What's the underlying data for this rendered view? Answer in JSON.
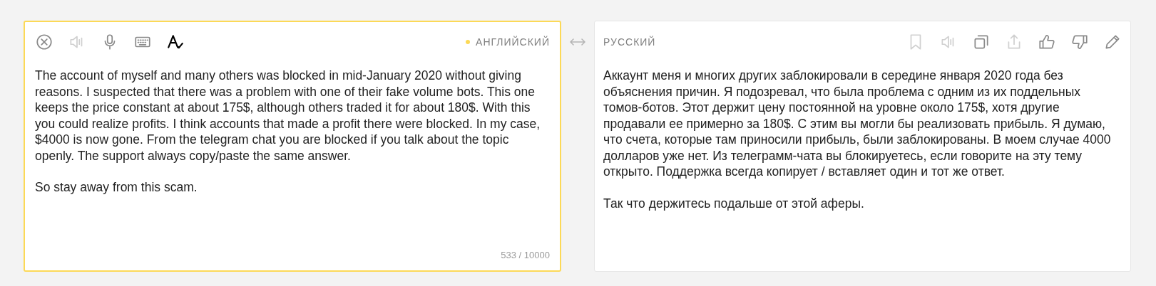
{
  "source": {
    "language": "АНГЛИЙСКИЙ",
    "tools": [
      {
        "kind": "clear",
        "disabled": false
      },
      {
        "kind": "speaker",
        "disabled": true
      },
      {
        "kind": "mic",
        "disabled": false
      },
      {
        "kind": "keyboard",
        "disabled": false
      },
      {
        "kind": "spellcheck",
        "disabled": false
      }
    ],
    "paragraphs": [
      "The account of myself and many others was blocked in mid-January 2020 without giving reasons. I suspected that there was a problem with one of their fake volume bots. This one keeps the price constant at about 175$, although others traded it for about 180$. With this you could realize profits. I think accounts that made a profit there were blocked. In my case, $4000 is now gone. From the telegram chat you are blocked if you talk about the topic openly. The support always copy/paste the same answer.",
      "So stay away from this scam."
    ],
    "counter": "533 / 10000"
  },
  "target": {
    "language": "РУССКИЙ",
    "tools": [
      {
        "kind": "bookmark",
        "disabled": true
      },
      {
        "kind": "speaker",
        "disabled": true
      },
      {
        "kind": "copy",
        "disabled": false
      },
      {
        "kind": "share",
        "disabled": true
      },
      {
        "kind": "like",
        "disabled": false
      },
      {
        "kind": "dislike",
        "disabled": false
      },
      {
        "kind": "edit",
        "disabled": false
      }
    ],
    "paragraphs": [
      "Аккаунт меня и многих других заблокировали в середине января 2020 года без объяснения причин. Я подозревал, что была проблема с одним из их поддельных томов-ботов. Этот держит цену постоянной на уровне около 175$, хотя другие продавали ее примерно за 180$. С этим вы могли бы реализовать прибыль. Я думаю, что счета, которые там приносили прибыль, были заблокированы. В моем случае 4000 долларов уже нет. Из телеграмм-чата вы блокируетесь, если говорите на эту тему открыто. Поддержка всегда копирует / вставляет один и тот же ответ.",
      "Так что держитесь подальше от этой аферы."
    ]
  }
}
